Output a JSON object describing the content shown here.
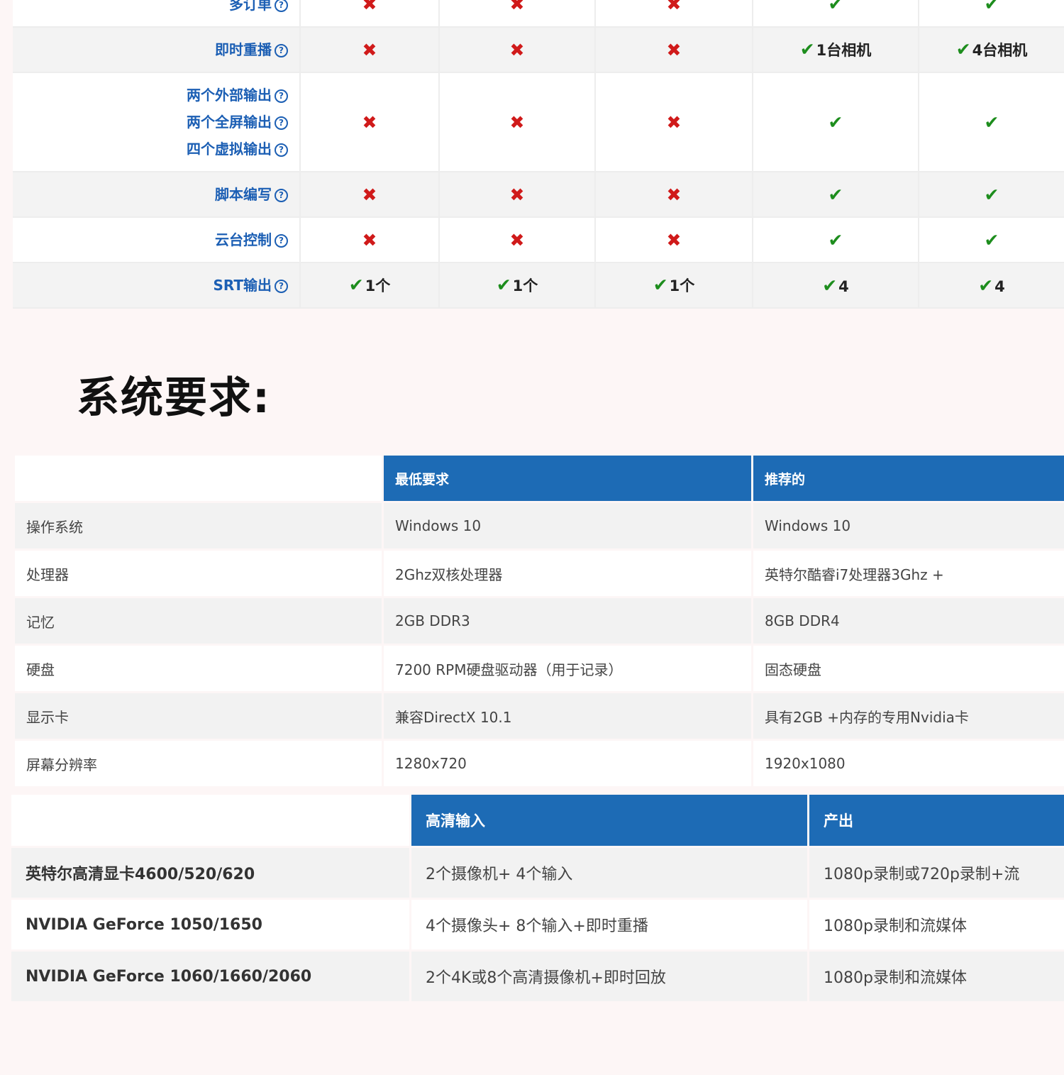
{
  "feature_table": {
    "rows": [
      {
        "feature": "多订单",
        "help": "?",
        "cells": [
          {
            "mark": "✖",
            "kind": "x",
            "text": ""
          },
          {
            "mark": "✖",
            "kind": "x",
            "text": ""
          },
          {
            "mark": "✖",
            "kind": "x",
            "text": ""
          },
          {
            "mark": "✔",
            "kind": "c",
            "text": ""
          },
          {
            "mark": "✔",
            "kind": "c",
            "text": ""
          }
        ]
      },
      {
        "feature": "即时重播",
        "help": "?",
        "cells": [
          {
            "mark": "✖",
            "kind": "x",
            "text": ""
          },
          {
            "mark": "✖",
            "kind": "x",
            "text": ""
          },
          {
            "mark": "✖",
            "kind": "x",
            "text": ""
          },
          {
            "mark": "✔",
            "kind": "c",
            "text": "1台相机"
          },
          {
            "mark": "✔",
            "kind": "c",
            "text": "4台相机"
          }
        ]
      },
      {
        "feature_lines": [
          "两个外部输出",
          "两个全屏输出",
          "四个虚拟输出"
        ],
        "help": "?",
        "cells": [
          {
            "mark": "✖",
            "kind": "x",
            "text": ""
          },
          {
            "mark": "✖",
            "kind": "x",
            "text": ""
          },
          {
            "mark": "✖",
            "kind": "x",
            "text": ""
          },
          {
            "mark": "✔",
            "kind": "c",
            "text": ""
          },
          {
            "mark": "✔",
            "kind": "c",
            "text": ""
          }
        ]
      },
      {
        "feature": "脚本编写",
        "help": "?",
        "cells": [
          {
            "mark": "✖",
            "kind": "x",
            "text": ""
          },
          {
            "mark": "✖",
            "kind": "x",
            "text": ""
          },
          {
            "mark": "✖",
            "kind": "x",
            "text": ""
          },
          {
            "mark": "✔",
            "kind": "c",
            "text": ""
          },
          {
            "mark": "✔",
            "kind": "c",
            "text": ""
          }
        ]
      },
      {
        "feature": "云台控制",
        "help": "?",
        "cells": [
          {
            "mark": "✖",
            "kind": "x",
            "text": ""
          },
          {
            "mark": "✖",
            "kind": "x",
            "text": ""
          },
          {
            "mark": "✖",
            "kind": "x",
            "text": ""
          },
          {
            "mark": "✔",
            "kind": "c",
            "text": ""
          },
          {
            "mark": "✔",
            "kind": "c",
            "text": ""
          }
        ]
      },
      {
        "feature": "SRT输出",
        "help": "?",
        "cells": [
          {
            "mark": "✔",
            "kind": "c",
            "text": "1个"
          },
          {
            "mark": "✔",
            "kind": "c",
            "text": "1个"
          },
          {
            "mark": "✔",
            "kind": "c",
            "text": "1个"
          },
          {
            "mark": "✔",
            "kind": "c",
            "text": "4"
          },
          {
            "mark": "✔",
            "kind": "c",
            "text": "4"
          }
        ]
      }
    ]
  },
  "system_requirements": {
    "heading": "系统要求:",
    "headers": [
      "",
      "最低要求",
      "推荐的"
    ],
    "rows": [
      [
        "操作系统",
        "Windows 10",
        "Windows 10"
      ],
      [
        "处理器",
        "2Ghz双核处理器",
        "英特尔酷睿i7处理器3Ghz +"
      ],
      [
        "记忆",
        "2GB DDR3",
        "8GB DDR4"
      ],
      [
        "硬盘",
        "7200 RPM硬盘驱动器（用于记录）",
        "固态硬盘"
      ],
      [
        "显示卡",
        "兼容DirectX 10.1",
        "具有2GB +内存的专用Nvidia卡"
      ],
      [
        "屏幕分辨率",
        "1280x720",
        "1920x1080"
      ]
    ]
  },
  "gpu_table": {
    "headers": [
      "",
      "高清输入",
      "产出"
    ],
    "rows": [
      [
        "英特尔高清显卡4600/520/620",
        "2个摄像机+ 4个输入",
        "1080p录制或720p录制+流"
      ],
      [
        "NVIDIA GeForce 1050/1650",
        "4个摄像头+ 8个输入+即时重播",
        "1080p录制和流媒体"
      ],
      [
        "NVIDIA GeForce 1060/1660/2060",
        "2个4K或8个高清摄像机+即时回放",
        "1080p录制和流媒体"
      ]
    ]
  },
  "colors": {
    "header_blue": "#1d6bb5",
    "link_blue": "#1c5fb4",
    "cross_red": "#d01a1a",
    "check_green": "#1d8d1d"
  }
}
